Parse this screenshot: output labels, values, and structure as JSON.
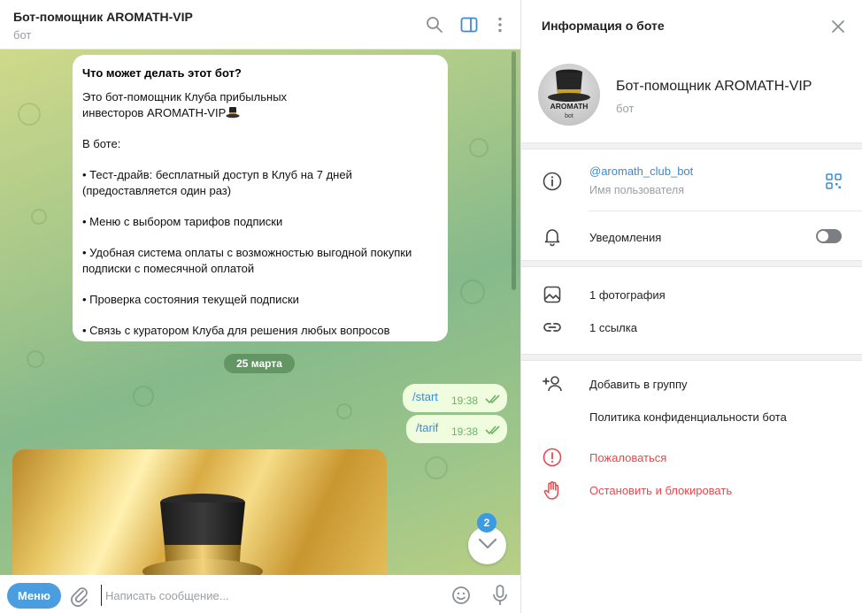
{
  "chat": {
    "title": "Бот-помощник AROMATH-VIP",
    "subtitle": "бот",
    "intro": {
      "title": "Что может делать этот бот?",
      "lines": [
        "Это бот-помощник Клуба прибыльных",
        "инвесторов AROMATH-VIP",
        "",
        "В боте:",
        "",
        "• Тест-драйв: бесплатный доступ в Клуб на 7 дней",
        "(предоставляется один раз)",
        "",
        "• Меню с выбором тарифов подписки",
        "",
        "• Удобная система оплаты с возможностью выгодной покупки",
        "подписки с помесячной оплатой",
        "",
        "• Проверка состояния текущей подписки",
        "",
        "• Связь с куратором Клуба для решения любых вопросов"
      ]
    },
    "date_label": "25 марта",
    "messages": [
      {
        "text": "/start",
        "time": "19:38"
      },
      {
        "text": "/tarif",
        "time": "19:38"
      }
    ],
    "unread_count": "2",
    "composer": {
      "menu_label": "Меню",
      "placeholder": "Написать сообщение..."
    }
  },
  "info_panel": {
    "title": "Информация о боте",
    "bot_name": "Бот-помощник AROMATH-VIP",
    "bot_sub": "бот",
    "avatar_text_main": "AROMATH",
    "avatar_text_sub": "bot",
    "username": "@aromath_club_bot",
    "username_caption": "Имя пользователя",
    "notifications_label": "Уведомления",
    "notifications_on": false,
    "media": [
      {
        "icon": "photo-icon",
        "label": "1 фотография"
      },
      {
        "icon": "link-icon",
        "label": "1 ссылка"
      }
    ],
    "actions": [
      {
        "icon": "add-user-icon",
        "label": "Добавить в группу"
      },
      {
        "icon": "",
        "label": "Политика конфиденциальности бота"
      }
    ],
    "danger_actions": [
      {
        "icon": "report-icon",
        "label": "Пожаловаться"
      },
      {
        "icon": "hand-stop-icon",
        "label": "Остановить и блокировать"
      }
    ]
  },
  "colors": {
    "accent": "#3a8bd1",
    "menu_button": "#4a9ee0",
    "danger": "#e5484d",
    "outgoing_bubble": "#effdde",
    "read_ticks": "#6eb166"
  }
}
